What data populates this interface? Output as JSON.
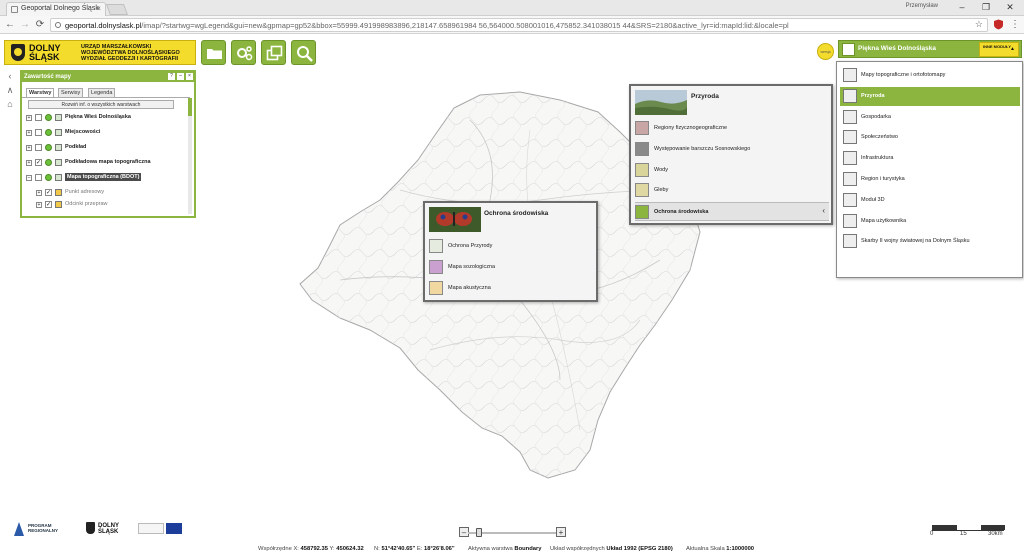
{
  "browser": {
    "tab_title": "Geoportal Dolnego Śląsk",
    "tab_close": "×",
    "user": "Przemysław",
    "url_host": "geoportal.dolnyslask.pl",
    "url_path": "/imap/?startwg=wgLegend&gui=new&gpmap=gp52&bbox=55999.491998983896,218147.658961984 56,564000.508001016,475852.341038015 44&SRS=2180&active_lyr=id:mapId:lid:&locale=pl",
    "win_min": "–",
    "win_max": "❐",
    "win_close": "✕",
    "back": "←",
    "forward": "→",
    "reload": "⟳",
    "star": "☆",
    "menu": "⋮"
  },
  "header": {
    "logo_name_1": "DOLNY",
    "logo_name_2": "ŚLĄSK",
    "logo_office": "URZĄD MARSZAŁKOWSKI WOJEWÓDZTWA DOLNOŚLĄSKIEGO WYDZIAŁ GEODEZJI I KARTOGRAFII",
    "lang_badge": "wersja",
    "theme_selected": "Piękna Wieś Dolnośląska",
    "inne_moduly": "INNE MODUŁY",
    "inne_arrow": "▲",
    "colors": {
      "green": "#8bb53f",
      "yellow": "#f4dc2c"
    }
  },
  "theme_menu": [
    {
      "label": "Mapy topograficzne i ortofotomapy",
      "active": false
    },
    {
      "label": "Przyroda",
      "active": true
    },
    {
      "label": "Gospodarka",
      "active": false
    },
    {
      "label": "Społeczeństwo",
      "active": false
    },
    {
      "label": "Infrastruktura",
      "active": false
    },
    {
      "label": "Region i turystyka",
      "active": false
    },
    {
      "label": "Moduł 3D",
      "active": false
    },
    {
      "label": "Mapa użytkownika",
      "active": false
    },
    {
      "label": "Skarby II wojny światowej na Dolnym Śląsku",
      "active": false
    }
  ],
  "sidenav": {
    "collapse": "‹",
    "up": "∧",
    "home": "⌂"
  },
  "contents_panel": {
    "title": "Zawartość mapy",
    "help": "?",
    "minimize": "–",
    "close": "×",
    "tabs": [
      "Warstwy",
      "Serwisy",
      "Legenda"
    ],
    "expand_all": "Rozwiń inf. o wszystkich warstwach",
    "layers": [
      {
        "label": "Piękna Wieś Dolnośląska",
        "checked": false,
        "exp": "+"
      },
      {
        "label": "Miejscowości",
        "checked": false,
        "exp": "+"
      },
      {
        "label": "Podkład",
        "checked": false,
        "exp": "+"
      },
      {
        "label": "Podkładowa mapa topograficzna",
        "checked": true,
        "exp": "+"
      },
      {
        "label": "Mapa topograficzna (BDOT)",
        "checked": false,
        "exp": "–"
      }
    ],
    "sublayers": [
      {
        "label": "Punkt adresowy",
        "exp": "+"
      },
      {
        "label": "Odcinki przepraw",
        "exp": "+"
      }
    ],
    "check_mark": "✓"
  },
  "popup_przyroda": {
    "title": "Przyroda",
    "items": [
      {
        "label": "Regiony fizycznogeograficzne",
        "selected": false
      },
      {
        "label": "Występowanie barszczu Sosnowskiego",
        "selected": false
      },
      {
        "label": "Wody",
        "selected": false
      },
      {
        "label": "Gleby",
        "selected": false
      },
      {
        "label": "Ochrona środowiska",
        "selected": true
      }
    ],
    "chevron": "‹"
  },
  "popup_ochrona": {
    "title": "Ochrona środowiska",
    "items": [
      {
        "label": "Ochrona Przyrody"
      },
      {
        "label": "Mapa sozologiczna"
      },
      {
        "label": "Mapa akustyczna"
      }
    ]
  },
  "footer": {
    "program_1": "PROGRAM",
    "program_2": "REGIONALNY",
    "ds_1": "DOLNY",
    "ds_2": "ŚLĄSK",
    "zoom_minus": "–",
    "zoom_plus": "+",
    "scale_labels": [
      "0",
      "15",
      "30km"
    ]
  },
  "status": {
    "coords_label": "Współrzędne X:",
    "x": "458792.35",
    "y_label": "Y:",
    "y": "450624.32",
    "n_label": "N:",
    "n": "51°42'40.65\"",
    "e_label": "E:",
    "e": "18°26'8.06\"",
    "active_layer_label": "Aktywna warstwa",
    "active_layer": "Boundary",
    "crs_label": "Układ współrzędnych",
    "crs": "Układ 1992 (EPSG 2180)",
    "scale_label": "Aktualna Skala",
    "scale": "1:1000000"
  }
}
